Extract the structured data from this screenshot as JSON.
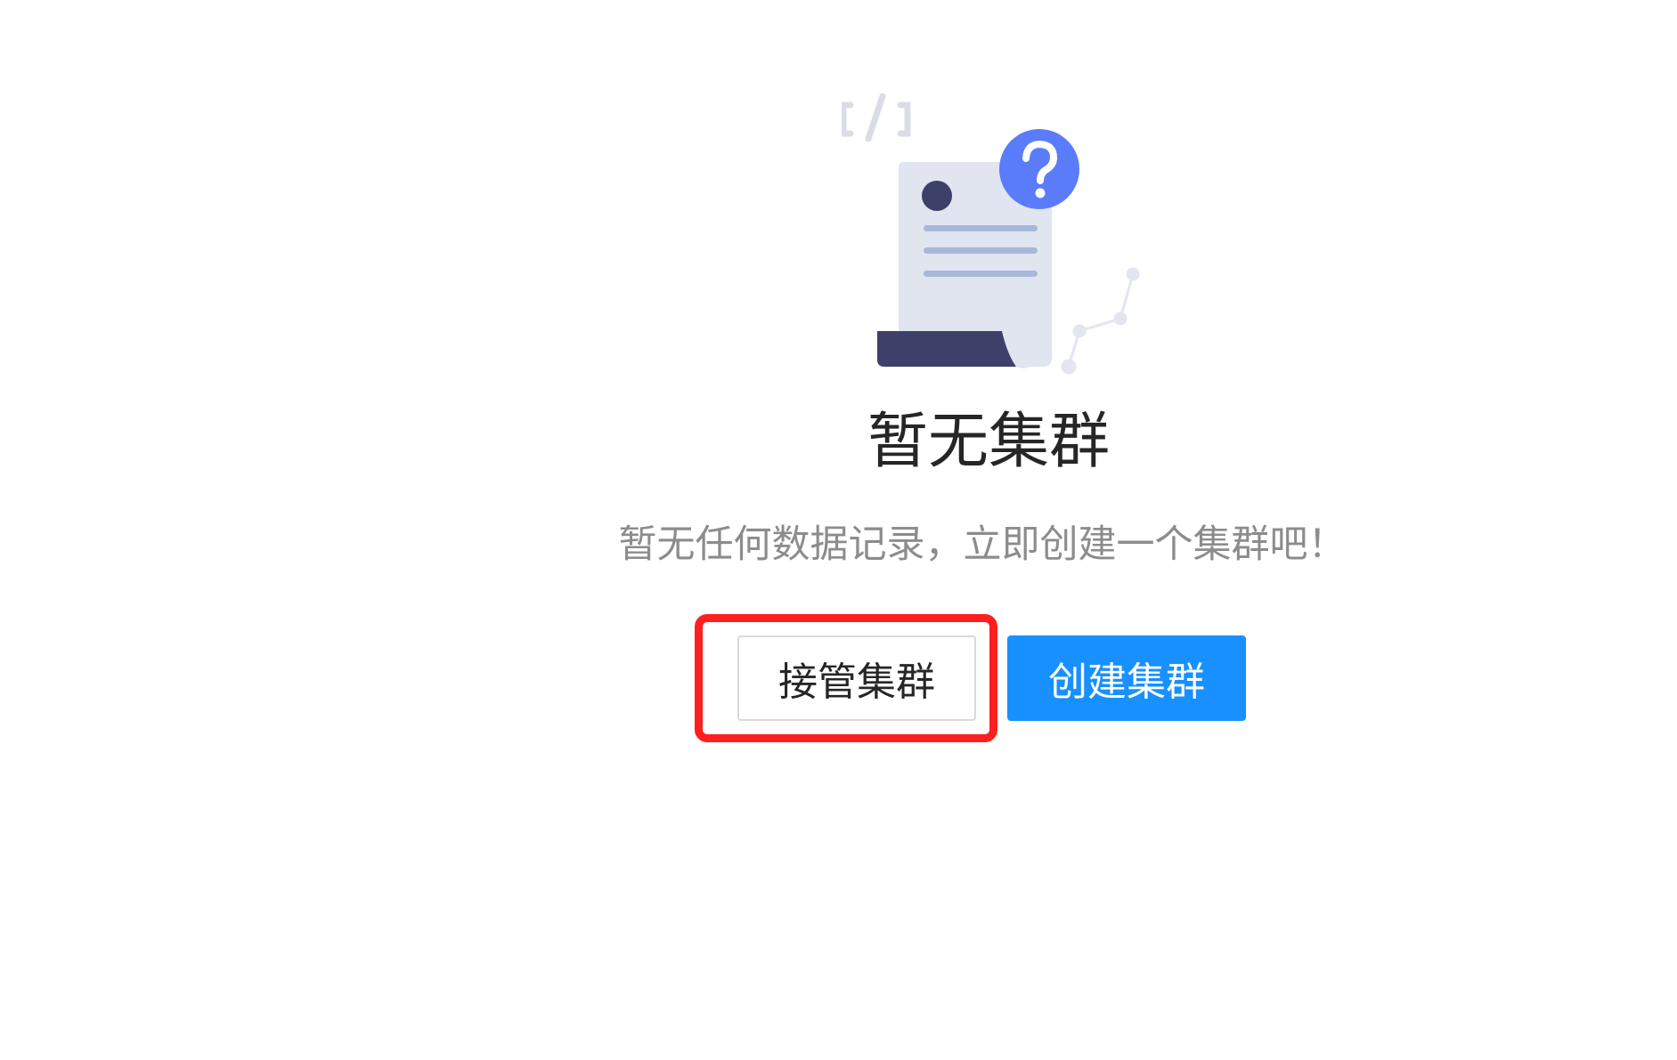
{
  "empty_state": {
    "title": "暂无集群",
    "description": "暂无任何数据记录，立即创建一个集群吧！",
    "illustration_icon": "document-question-icon",
    "accent_color": "#5b7cfa"
  },
  "actions": {
    "takeover_label": "接管集群",
    "create_label": "创建集群",
    "primary_color": "#1890ff",
    "highlight_color": "#ff1f1f"
  }
}
